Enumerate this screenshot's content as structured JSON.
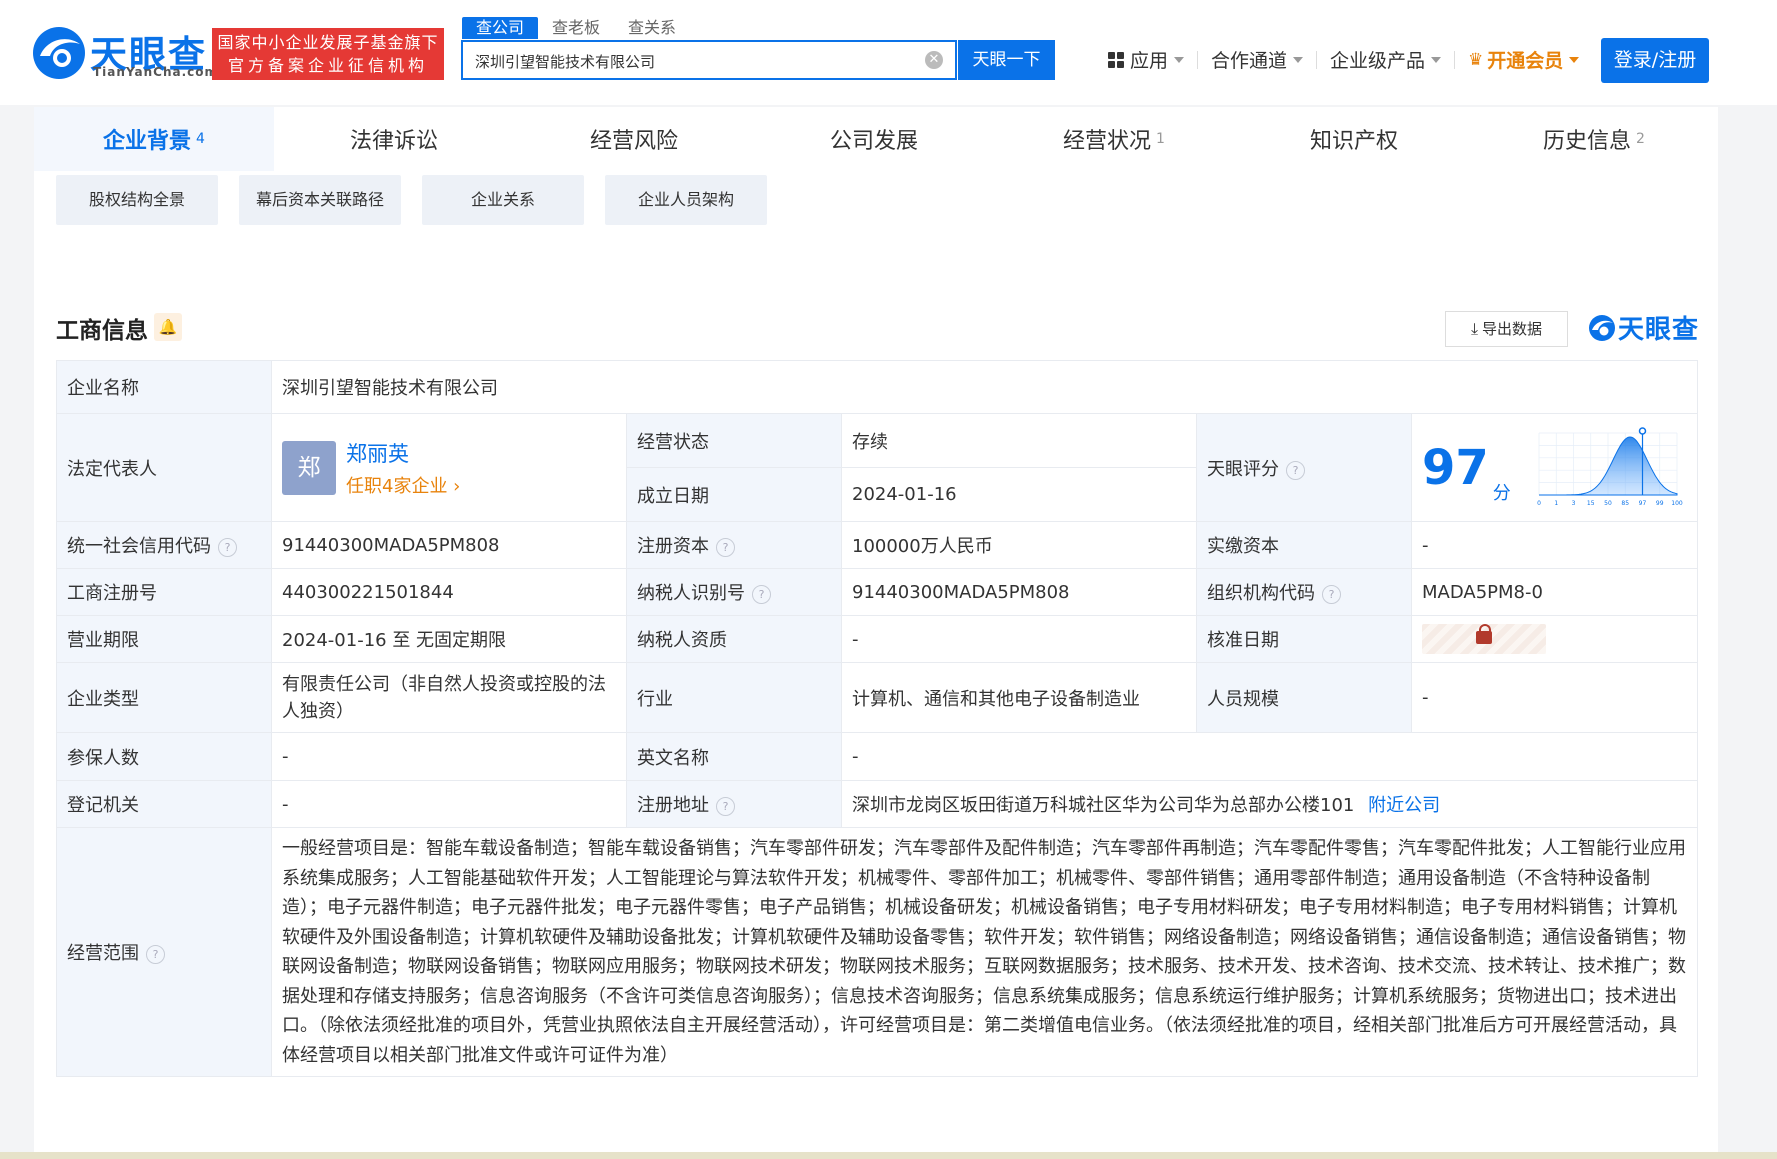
{
  "header": {
    "logo_cn": "天眼查",
    "logo_en": "TianYanCha.com",
    "badge_line1": "国家中小企业发展子基金旗下",
    "badge_line2": "官方备案企业征信机构",
    "search_tabs": [
      "查公司",
      "查老板",
      "查关系"
    ],
    "search_value": "深圳引望智能技术有限公司",
    "search_button": "天眼一下",
    "nav": {
      "apps": "应用",
      "partner": "合作通道",
      "enterprise": "企业级产品",
      "vip": "开通会员"
    },
    "login": "登录/注册",
    "colors": {
      "brand": "#0a72e8",
      "badge": "#e53935",
      "vip": "#e8830c"
    }
  },
  "main_tabs": [
    {
      "label": "企业背景",
      "count": "4"
    },
    {
      "label": "法律诉讼",
      "count": ""
    },
    {
      "label": "经营风险",
      "count": ""
    },
    {
      "label": "公司发展",
      "count": ""
    },
    {
      "label": "经营状况",
      "count": "1"
    },
    {
      "label": "知识产权",
      "count": ""
    },
    {
      "label": "历史信息",
      "count": "2"
    }
  ],
  "sub_tabs": [
    "股权结构全景",
    "幕后资本关联路径",
    "企业关系",
    "企业人员架构"
  ],
  "section": {
    "title": "工商信息",
    "export": "导出数据",
    "watermark": "天眼查"
  },
  "info": {
    "company_name_label": "企业名称",
    "company_name": "深圳引望智能技术有限公司",
    "legal_rep_label": "法定代表人",
    "legal_rep_avatar": "郑",
    "legal_rep_name": "郑丽英",
    "legal_rep_sub": "任职4家企业 ›",
    "status_label": "经营状态",
    "status": "存续",
    "founded_label": "成立日期",
    "founded": "2024-01-16",
    "score_label": "天眼评分",
    "score": "97",
    "score_unit": "分",
    "score_axis": [
      "0",
      "1",
      "3",
      "15",
      "50",
      "85",
      "97",
      "99",
      "100"
    ],
    "credit_code_label": "统一社会信用代码",
    "credit_code": "91440300MADA5PM808",
    "reg_capital_label": "注册资本",
    "reg_capital": "100000万人民币",
    "paid_capital_label": "实缴资本",
    "paid_capital": "-",
    "reg_no_label": "工商注册号",
    "reg_no": "440300221501844",
    "tax_id_label": "纳税人识别号",
    "tax_id": "91440300MADA5PM808",
    "org_code_label": "组织机构代码",
    "org_code": "MADA5PM8-0",
    "term_label": "营业期限",
    "term": "2024-01-16 至 无固定期限",
    "taxpayer_label": "纳税人资质",
    "taxpayer": "-",
    "approve_label": "核准日期",
    "type_label": "企业类型",
    "type": "有限责任公司（非自然人投资或控股的法人独资）",
    "industry_label": "行业",
    "industry": "计算机、通信和其他电子设备制造业",
    "staff_label": "人员规模",
    "staff": "-",
    "insured_label": "参保人数",
    "insured": "-",
    "en_name_label": "英文名称",
    "en_name": "-",
    "authority_label": "登记机关",
    "authority": "-",
    "address_label": "注册地址",
    "address": "深圳市龙岗区坂田街道万科城社区华为公司华为总部办公楼101",
    "nearby": "附近公司",
    "scope_label": "经营范围",
    "scope": "一般经营项目是：智能车载设备制造；智能车载设备销售；汽车零部件研发；汽车零部件及配件制造；汽车零部件再制造；汽车零配件零售；汽车零配件批发；人工智能行业应用系统集成服务；人工智能基础软件开发；人工智能理论与算法软件开发；机械零件、零部件加工；机械零件、零部件销售；通用零部件制造；通用设备制造（不含特种设备制造）；电子元器件制造；电子元器件批发；电子元器件零售；电子产品销售；机械设备研发；机械设备销售；电子专用材料研发；电子专用材料制造；电子专用材料销售；计算机软硬件及外围设备制造；计算机软硬件及辅助设备批发；计算机软硬件及辅助设备零售；软件开发；软件销售；网络设备制造；网络设备销售；通信设备制造；通信设备销售；物联网设备制造；物联网设备销售；物联网应用服务；物联网技术研发；物联网技术服务；互联网数据服务；技术服务、技术开发、技术咨询、技术交流、技术转让、技术推广；数据处理和存储支持服务；信息咨询服务（不含许可类信息咨询服务）；信息技术咨询服务；信息系统集成服务；信息系统运行维护服务；计算机系统服务；货物进出口；技术进出口。（除依法须经批准的项目外，凭营业执照依法自主开展经营活动），许可经营项目是：第二类增值电信业务。（依法须经批准的项目，经相关部门批准后方可开展经营活动，具体经营项目以相关部门批准文件或许可证件为准）"
  }
}
